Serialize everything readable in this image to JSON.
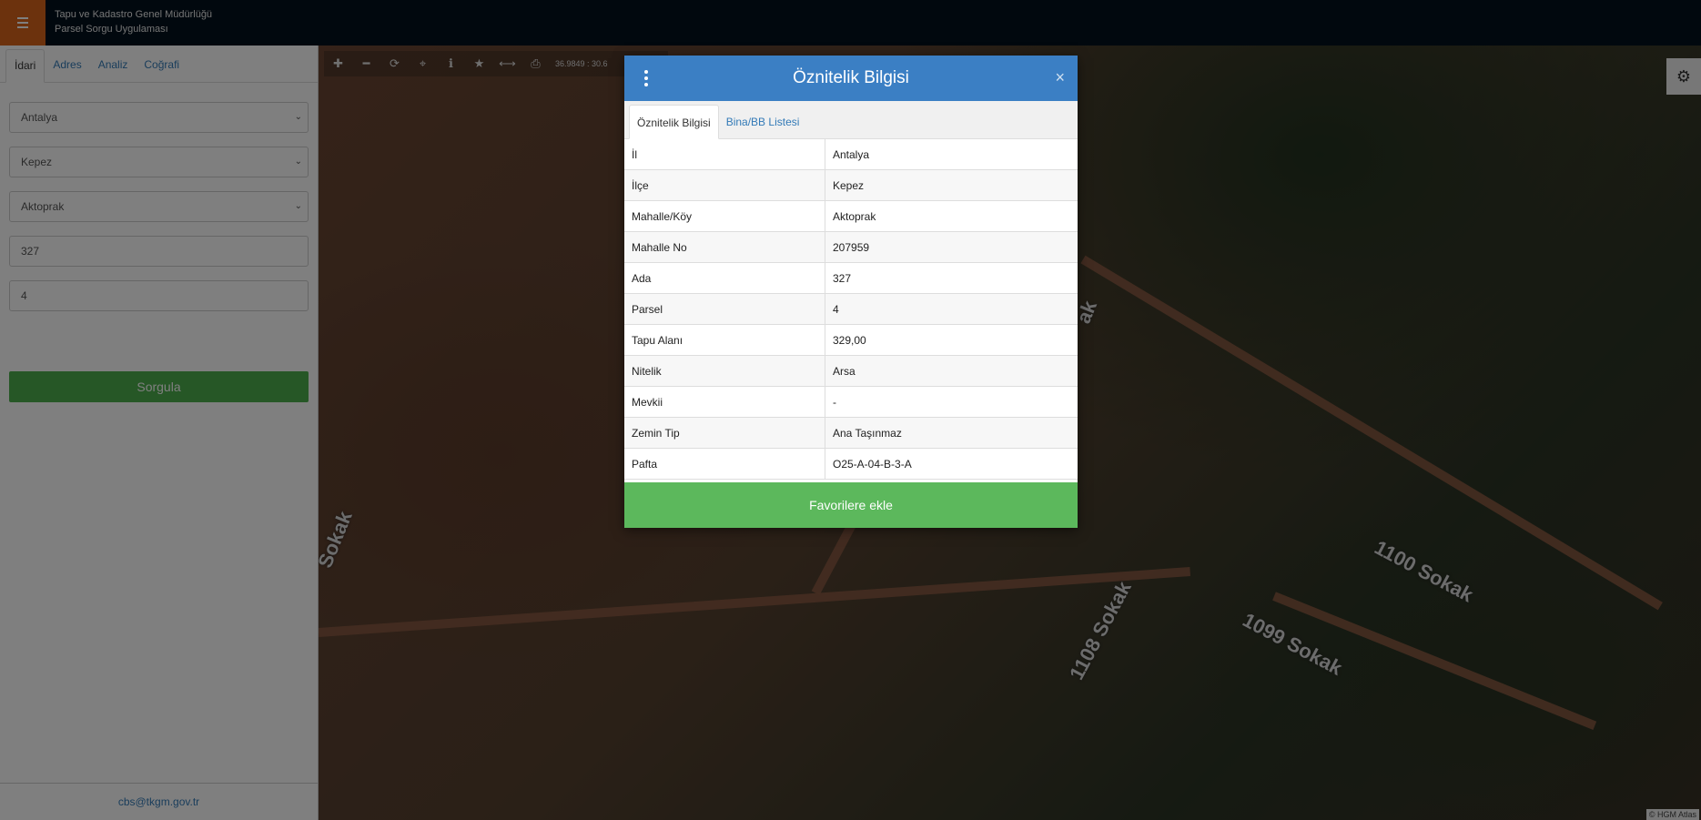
{
  "header": {
    "title_line1": "Tapu ve Kadastro Genel Müdürlüğü",
    "title_line2": "Parsel Sorgu Uygulaması"
  },
  "sidebar": {
    "tabs": [
      {
        "label": "İdari",
        "active": true
      },
      {
        "label": "Adres",
        "active": false
      },
      {
        "label": "Analiz",
        "active": false
      },
      {
        "label": "Coğrafi",
        "active": false
      }
    ],
    "il_select": "Antalya",
    "ilce_select": "Kepez",
    "mahalle_select": "Aktoprak",
    "ada_input": "327",
    "parsel_input": "4",
    "query_button": "Sorgula",
    "footer_email": "cbs@tkgm.gov.tr"
  },
  "map": {
    "coordinates": "36.9849 : 30.6",
    "roads": [
      "1100 Sokak",
      "1099 Sokak",
      "1108 Sokak",
      "Sokak",
      "ak"
    ],
    "attribution": "© HGM Atlas"
  },
  "modal": {
    "title": "Öznitelik Bilgisi",
    "tabs": [
      {
        "label": "Öznitelik Bilgisi",
        "active": true
      },
      {
        "label": "Bina/BB Listesi",
        "active": false
      }
    ],
    "rows": [
      {
        "key": "İl",
        "value": "Antalya"
      },
      {
        "key": "İlçe",
        "value": "Kepez"
      },
      {
        "key": "Mahalle/Köy",
        "value": "Aktoprak"
      },
      {
        "key": "Mahalle No",
        "value": "207959"
      },
      {
        "key": "Ada",
        "value": "327"
      },
      {
        "key": "Parsel",
        "value": "4"
      },
      {
        "key": "Tapu Alanı",
        "value": "329,00"
      },
      {
        "key": "Nitelik",
        "value": "Arsa"
      },
      {
        "key": "Mevkii",
        "value": "-"
      },
      {
        "key": "Zemin Tip",
        "value": "Ana Taşınmaz"
      },
      {
        "key": "Pafta",
        "value": "O25-A-04-B-3-A"
      }
    ],
    "favorite_button": "Favorilere ekle",
    "close_symbol": "×"
  },
  "colors": {
    "header_bg": "#02101c",
    "menu_accent": "#d9641a",
    "modal_header": "#3b7fc4",
    "success": "#5cb85c"
  }
}
